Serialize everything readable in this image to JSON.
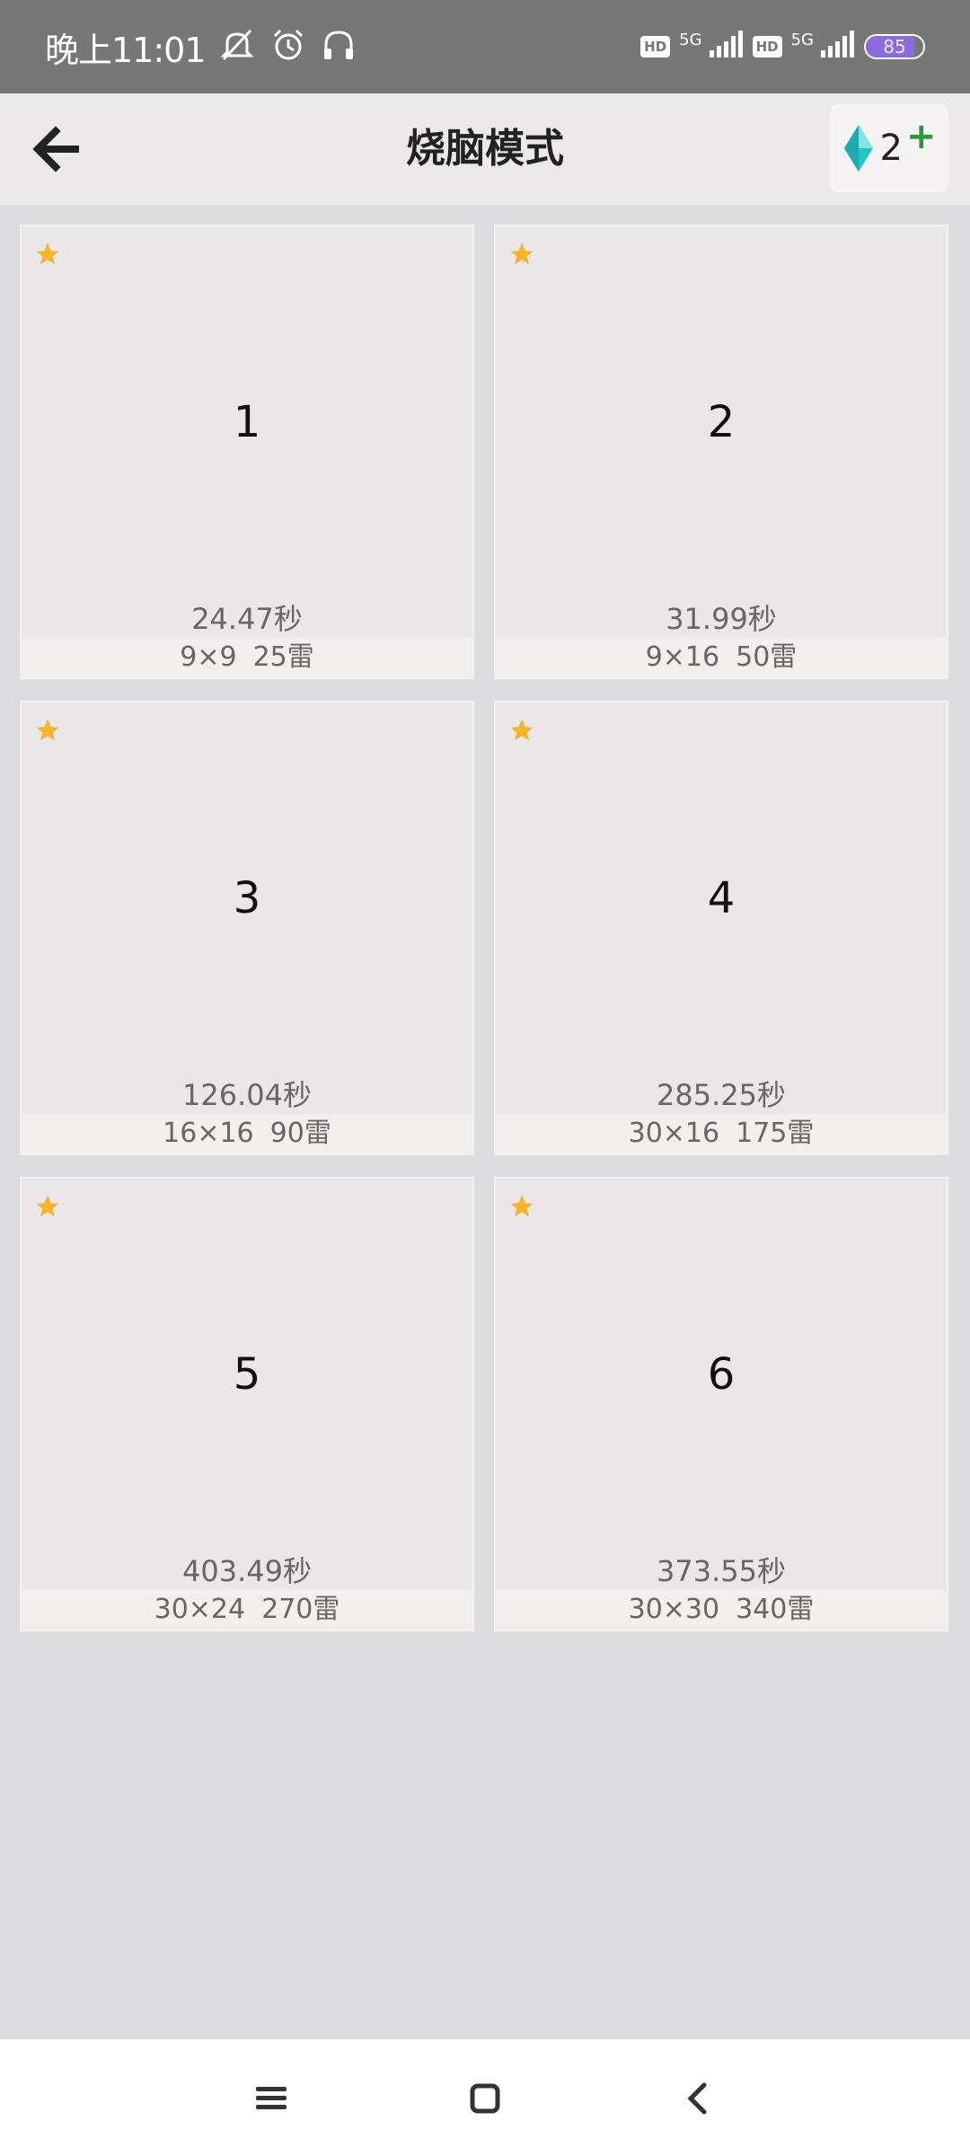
{
  "status_bar": {
    "time": "晚上11:01",
    "left_icons": [
      "mute-icon",
      "alarm-icon",
      "headphones-icon"
    ],
    "hd1": "HD",
    "net1": "5G",
    "hd2": "HD",
    "net2": "5G",
    "battery": "85"
  },
  "header": {
    "title": "烧脑模式",
    "gem_count": "2",
    "gem_plus": "+",
    "accent_gem": "#27c4c4",
    "accent_plus": "#2a9a3a"
  },
  "levels": [
    {
      "number": "1",
      "time": "24.47秒",
      "size": "9×9",
      "mines": "25雷"
    },
    {
      "number": "2",
      "time": "31.99秒",
      "size": "9×16",
      "mines": "50雷"
    },
    {
      "number": "3",
      "time": "126.04秒",
      "size": "16×16",
      "mines": "90雷"
    },
    {
      "number": "4",
      "time": "285.25秒",
      "size": "30×16",
      "mines": "175雷"
    },
    {
      "number": "5",
      "time": "403.49秒",
      "size": "30×24",
      "mines": "270雷"
    },
    {
      "number": "6",
      "time": "373.55秒",
      "size": "30×30",
      "mines": "340雷"
    }
  ],
  "star_color": "#f5b52a",
  "nav": [
    "menu-icon",
    "home-icon",
    "back-icon"
  ]
}
